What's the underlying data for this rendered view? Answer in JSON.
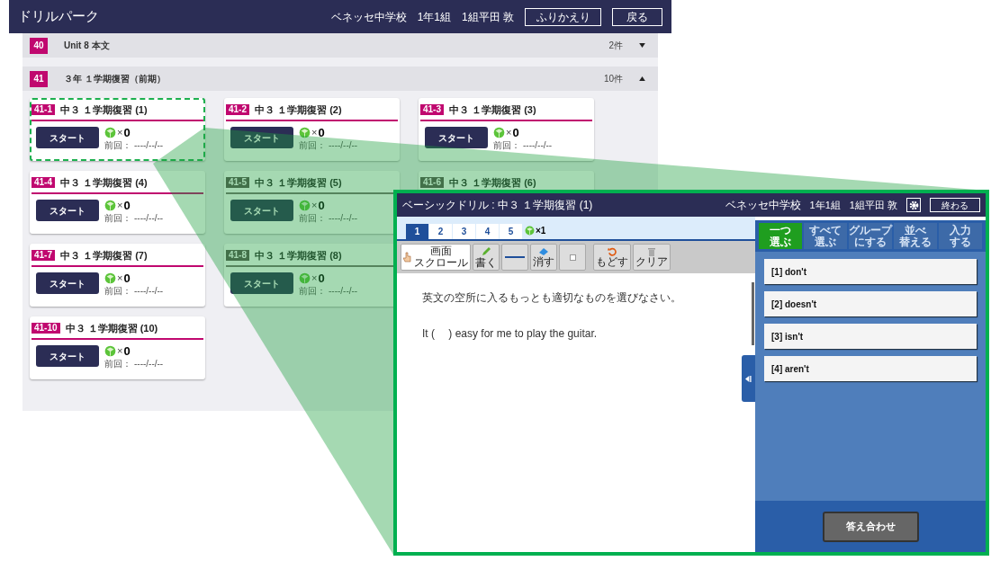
{
  "app_header": {
    "title": "ドリルパーク",
    "school": "ベネッセ中学校",
    "class": "1年1組",
    "user": "1組平田 敦",
    "buttons": [
      "ふりかえり",
      "戻る"
    ]
  },
  "sections": [
    {
      "number": "40",
      "title": "Unit 8 本文",
      "count": "2件",
      "expanded": false
    },
    {
      "number": "41",
      "title": "３年 １学期復習（前期）",
      "count": "10件",
      "expanded": true,
      "card_rows": [
        [
          {
            "code": "41-1",
            "title": "中３ １学期復習 (1)",
            "available": true,
            "highlighted": true,
            "start": "スタート",
            "times": "×",
            "gems": "0",
            "last_label": "前回：",
            "last_date": "----/--/--"
          },
          {
            "code": "41-2",
            "title": "中３ １学期復習 (2)",
            "available": true,
            "highlighted": false,
            "start": "スタート",
            "times": "×",
            "gems": "0",
            "last_label": "前回：",
            "last_date": "----/--/--"
          },
          {
            "code": "41-3",
            "title": "中３ １学期復習 (3)",
            "available": true,
            "highlighted": false,
            "start": "スタート",
            "times": "×",
            "gems": "0",
            "last_label": "前回：",
            "last_date": "----/--/--"
          }
        ],
        [
          {
            "code": "41-4",
            "title": "中３ １学期復習 (4)",
            "available": true,
            "highlighted": false,
            "start": "スタート",
            "times": "×",
            "gems": "0",
            "last_label": "前回：",
            "last_date": "----/--/--"
          },
          {
            "code": "41-5",
            "title": "中３ １学期復習 (5)",
            "available": false,
            "highlighted": false,
            "start": "スタート",
            "times": "×",
            "gems": "0",
            "last_label": "前回：",
            "last_date": "----/--/--"
          },
          {
            "code": "41-6",
            "title": "中３ １学期復習 (6)",
            "available": false,
            "highlighted": false
          }
        ],
        [
          {
            "code": "41-7",
            "title": "中３ １学期復習 (7)",
            "available": true,
            "highlighted": false,
            "start": "スタート",
            "times": "×",
            "gems": "0",
            "last_label": "前回：",
            "last_date": "----/--/--"
          },
          {
            "code": "41-8",
            "title": "中３ １学期復習 (8)",
            "available": false,
            "highlighted": false,
            "start": "スタート",
            "times": "×",
            "gems": "0",
            "last_label": "前回：",
            "last_date": "----/--/--"
          }
        ],
        [
          {
            "code": "41-10",
            "title": "中３ １学期復習 (10)",
            "available": true,
            "highlighted": false,
            "start": "スタート",
            "times": "×",
            "gems": "0",
            "last_label": "前回：",
            "last_date": "----/--/--"
          }
        ]
      ]
    }
  ],
  "drill_window": {
    "title": "ベーシックドリル : 中３ １学期復習 (1)",
    "school": "ベネッセ中学校",
    "class": "1年1組",
    "user": "1組平田 敦",
    "end_button": "終わる",
    "question_tabs": [
      {
        "label": "1",
        "selected": true
      },
      {
        "label": "2",
        "selected": false
      },
      {
        "label": "3",
        "selected": false
      },
      {
        "label": "4",
        "selected": false
      },
      {
        "label": "5",
        "selected": false
      }
    ],
    "gem_count": "×1",
    "tools": [
      {
        "kind": "scroll",
        "lines": [
          "画面",
          "スクロール"
        ],
        "selected": true
      },
      {
        "kind": "pen",
        "lines": [
          "書く"
        ],
        "selected": false
      },
      {
        "kind": "line",
        "selected": false
      },
      {
        "kind": "eraser",
        "lines": [
          "消す"
        ],
        "selected": false
      },
      {
        "kind": "square",
        "selected": false
      },
      {
        "kind": "undo",
        "lines": [
          "もどす"
        ],
        "selected": false
      },
      {
        "kind": "clear",
        "lines": [
          "クリア"
        ],
        "selected": false
      }
    ],
    "instruction": "英文の空所に入るもっとも適切なものを選びなさい。",
    "question": "It (　 ) easy for me to play the guitar.",
    "answer_modes": [
      {
        "lines": [
          "一つ",
          "選ぶ"
        ],
        "selected": true
      },
      {
        "lines": [
          "すべて",
          "選ぶ"
        ],
        "selected": false
      },
      {
        "lines": [
          "グループ",
          "にする"
        ],
        "selected": false
      },
      {
        "lines": [
          "並べ",
          "替える"
        ],
        "selected": false
      },
      {
        "lines": [
          "入力",
          "する"
        ],
        "selected": false
      }
    ],
    "choices": [
      "[1] don't",
      "[2] doesn't",
      "[3] isn't",
      "[4] aren't"
    ],
    "check_button": "答え合わせ"
  }
}
